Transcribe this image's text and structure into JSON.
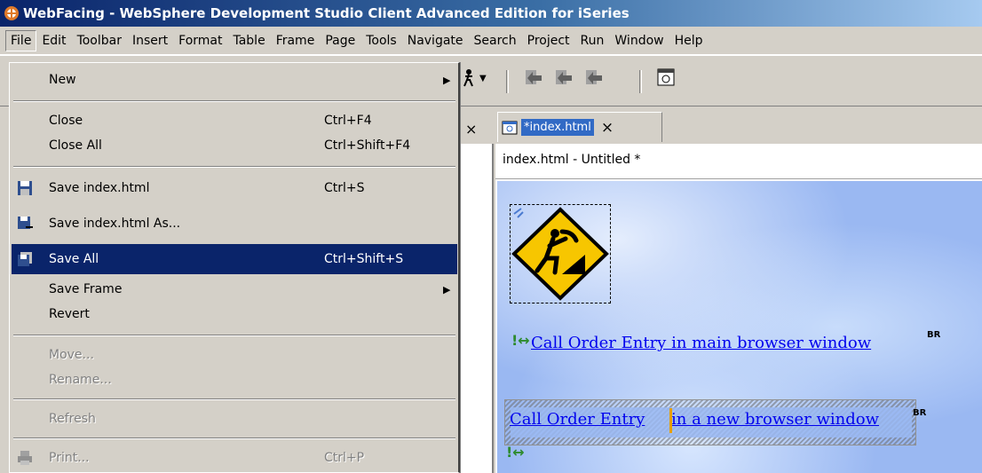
{
  "window": {
    "title": "WebFacing - WebSphere Development Studio Client Advanced Edition for iSeries"
  },
  "menubar": [
    "File",
    "Edit",
    "Toolbar",
    "Insert",
    "Format",
    "Table",
    "Frame",
    "Page",
    "Tools",
    "Navigate",
    "Search",
    "Project",
    "Run",
    "Window",
    "Help"
  ],
  "file_menu": {
    "new": {
      "label": "New"
    },
    "close": {
      "label": "Close",
      "accel": "Ctrl+F4"
    },
    "close_all": {
      "label": "Close All",
      "accel": "Ctrl+Shift+F4"
    },
    "save": {
      "label": "Save index.html",
      "accel": "Ctrl+S"
    },
    "save_as": {
      "label": "Save index.html As..."
    },
    "save_all": {
      "label": "Save All",
      "accel": "Ctrl+Shift+S"
    },
    "save_frame": {
      "label": "Save Frame"
    },
    "revert": {
      "label": "Revert"
    },
    "move": {
      "label": "Move..."
    },
    "rename": {
      "label": "Rename..."
    },
    "refresh": {
      "label": "Refresh"
    },
    "print": {
      "label": "Print...",
      "accel": "Ctrl+P"
    }
  },
  "editor": {
    "tab_label": "*index.html",
    "tab_close": "×",
    "left_close": "×",
    "header": "index.html - Untitled *",
    "link_main": "Call Order Entry in main browser window",
    "link_new_part1": "Call Order Entry ",
    "link_new_part2": "in a new browser window",
    "br_marker": "BR"
  },
  "colors": {
    "highlight": "#0a246a",
    "link": "#0000ee",
    "canvas": "#9ab8f2",
    "sign": "#f7c600"
  }
}
